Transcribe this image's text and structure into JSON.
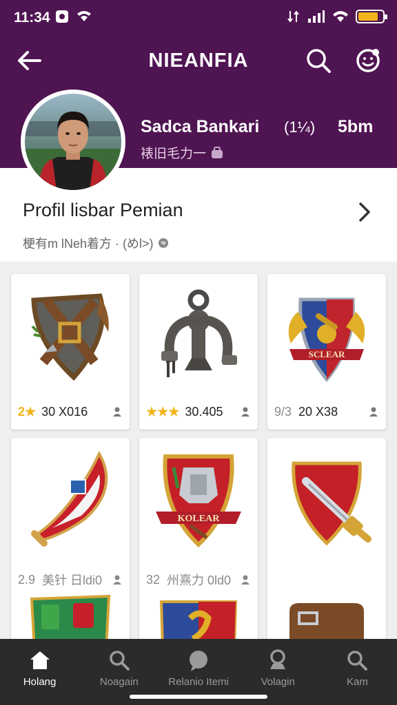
{
  "status_bar": {
    "time": "11:34"
  },
  "app_bar": {
    "title": "NIEANFIA"
  },
  "profile": {
    "name": "Sadca Bankari",
    "meta_a": "(1¼)",
    "meta_b": "5bm",
    "subtitle": "裱旧毛力一"
  },
  "info_card": {
    "title": "Profil lisbar Pemian",
    "subtitle": "梗有m  lNeh着方 · (めl>)"
  },
  "items": [
    {
      "level": "2★",
      "value": "30 X016",
      "icon": "shield-straps-icon"
    },
    {
      "level": "★★★",
      "value": "30.405",
      "icon": "iron-anchor-icon"
    },
    {
      "level": "9/3",
      "value": "20 X38",
      "icon": "winged-crest-icon"
    },
    {
      "level": "",
      "value": "",
      "icon": "red-horn-icon"
    },
    {
      "level": "",
      "value": "",
      "icon": "armor-crest-icon"
    },
    {
      "level": "",
      "value": "",
      "icon": "sword-shield-icon"
    }
  ],
  "row2_labels": [
    {
      "level": "2.9",
      "value": "美针 日ldi0"
    },
    {
      "level": "32",
      "value": "州熹力 0ld0"
    }
  ],
  "crest_banner": "SCLEAR",
  "crest_banner_2": "KOLEAR",
  "bottom_nav": [
    {
      "label": "Holang",
      "icon": "home-icon"
    },
    {
      "label": "Noagain",
      "icon": "search-icon"
    },
    {
      "label": "Relanio Itemi",
      "icon": "chat-icon"
    },
    {
      "label": "Volagin",
      "icon": "trophy-icon"
    },
    {
      "label": "Kam",
      "icon": "search-icon"
    }
  ],
  "colors": {
    "header": "#4f1452",
    "nav": "#2b2b2b",
    "accent_gold": "#f2b51b"
  }
}
